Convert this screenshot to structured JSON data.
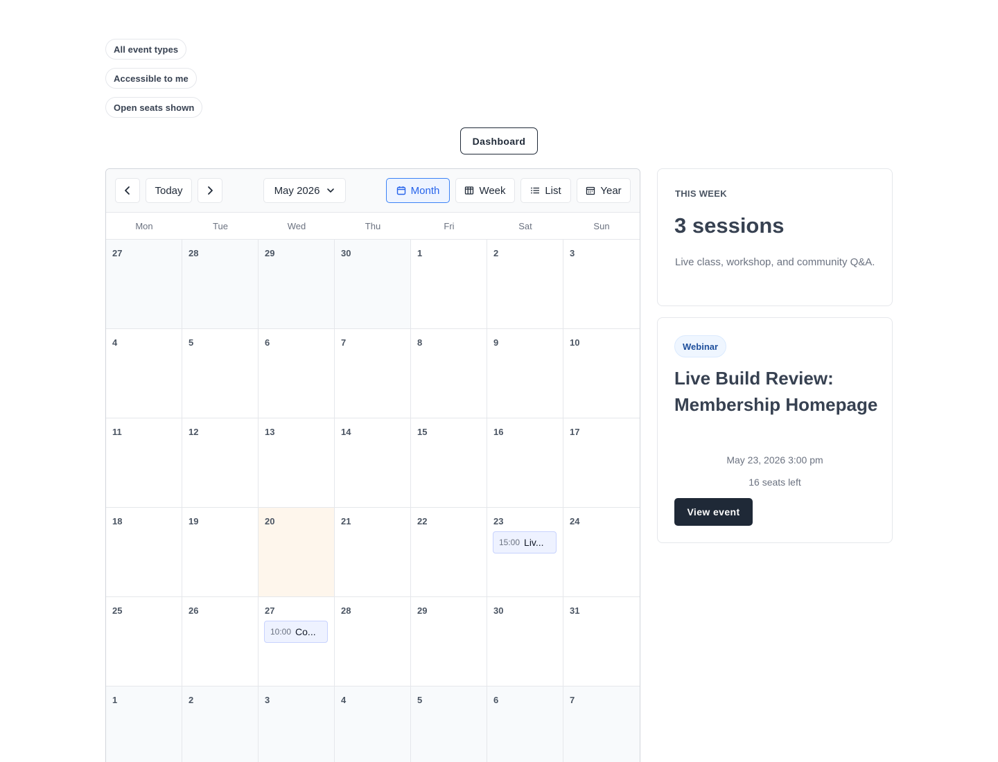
{
  "filters": [
    {
      "label": "All event types"
    },
    {
      "label": "Accessible to me"
    },
    {
      "label": "Open seats shown"
    }
  ],
  "dashboard_label": "Dashboard",
  "calendar": {
    "today_label": "Today",
    "month_label": "May 2026",
    "views": [
      "Month",
      "Week",
      "List",
      "Year"
    ],
    "active_view": "Month",
    "days_of_week": [
      "Mon",
      "Tue",
      "Wed",
      "Thu",
      "Fri",
      "Sat",
      "Sun"
    ],
    "weeks": [
      [
        {
          "d": "27",
          "other": true
        },
        {
          "d": "28",
          "other": true
        },
        {
          "d": "29",
          "other": true
        },
        {
          "d": "30",
          "other": true
        },
        {
          "d": "1"
        },
        {
          "d": "2"
        },
        {
          "d": "3"
        }
      ],
      [
        {
          "d": "4"
        },
        {
          "d": "5"
        },
        {
          "d": "6"
        },
        {
          "d": "7"
        },
        {
          "d": "8"
        },
        {
          "d": "9"
        },
        {
          "d": "10"
        }
      ],
      [
        {
          "d": "11"
        },
        {
          "d": "12"
        },
        {
          "d": "13"
        },
        {
          "d": "14"
        },
        {
          "d": "15"
        },
        {
          "d": "16"
        },
        {
          "d": "17"
        }
      ],
      [
        {
          "d": "18"
        },
        {
          "d": "19"
        },
        {
          "d": "20",
          "today": true
        },
        {
          "d": "21"
        },
        {
          "d": "22"
        },
        {
          "d": "23",
          "event": {
            "time": "15:00",
            "title": "Liv..."
          }
        },
        {
          "d": "24"
        }
      ],
      [
        {
          "d": "25"
        },
        {
          "d": "26"
        },
        {
          "d": "27",
          "event": {
            "time": "10:00",
            "title": "Co..."
          }
        },
        {
          "d": "28"
        },
        {
          "d": "29"
        },
        {
          "d": "30"
        },
        {
          "d": "31"
        }
      ],
      [
        {
          "d": "1",
          "other": true
        },
        {
          "d": "2",
          "other": true
        },
        {
          "d": "3",
          "other": true
        },
        {
          "d": "4",
          "other": true
        },
        {
          "d": "5",
          "other": true
        },
        {
          "d": "6",
          "other": true
        },
        {
          "d": "7",
          "other": true
        }
      ]
    ]
  },
  "week_card": {
    "eyebrow": "THIS WEEK",
    "count": "3 sessions",
    "description": "Live class, workshop, and community Q&A."
  },
  "event_card": {
    "badge": "Webinar",
    "title": "Live Build Review: Membership Homepage",
    "date": "May 23, 2026 3:00 pm",
    "seats": "16 seats left",
    "button": "View event"
  },
  "colors": {
    "accent": "#2563eb",
    "dark_button": "#1f2937",
    "today_bg": "#fef6ec",
    "event_bg": "#eef2ff"
  }
}
